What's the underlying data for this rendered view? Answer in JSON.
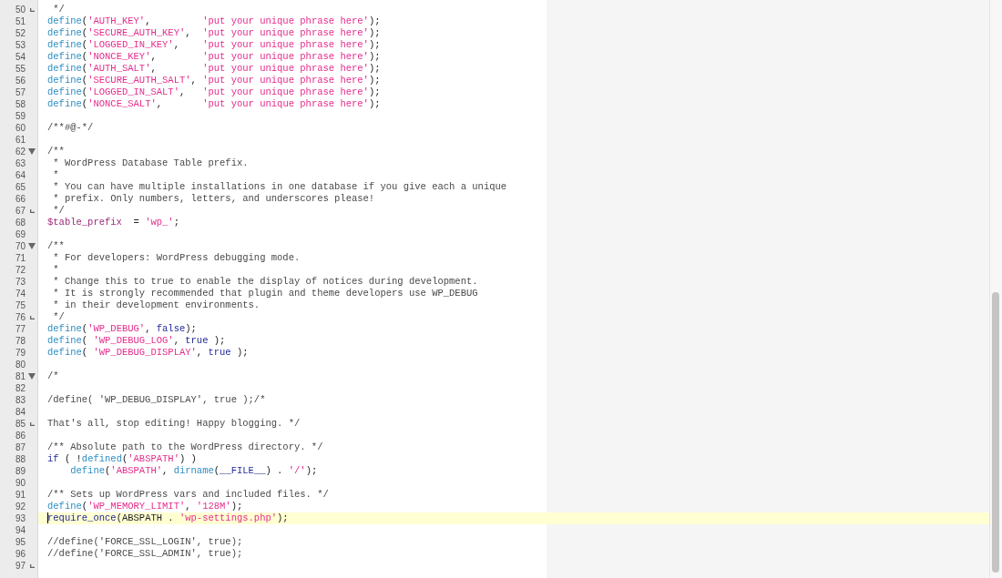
{
  "editor": {
    "lines": [
      {
        "number": "50",
        "fold_start": false,
        "fold_end": true,
        "current": false,
        "tokens": [
          {
            "kind": "comment",
            "text": " */"
          }
        ]
      },
      {
        "number": "51",
        "fold_start": false,
        "fold_end": false,
        "current": false,
        "tokens": [
          {
            "kind": "function",
            "text": "define"
          },
          {
            "kind": "plain",
            "text": "("
          },
          {
            "kind": "string",
            "text": "'AUTH_KEY'"
          },
          {
            "kind": "plain",
            "text": ",         "
          },
          {
            "kind": "string",
            "text": "'put your unique phrase here'"
          },
          {
            "kind": "plain",
            "text": ");"
          }
        ]
      },
      {
        "number": "52",
        "fold_start": false,
        "fold_end": false,
        "current": false,
        "tokens": [
          {
            "kind": "function",
            "text": "define"
          },
          {
            "kind": "plain",
            "text": "("
          },
          {
            "kind": "string",
            "text": "'SECURE_AUTH_KEY'"
          },
          {
            "kind": "plain",
            "text": ",  "
          },
          {
            "kind": "string",
            "text": "'put your unique phrase here'"
          },
          {
            "kind": "plain",
            "text": ");"
          }
        ]
      },
      {
        "number": "53",
        "fold_start": false,
        "fold_end": false,
        "current": false,
        "tokens": [
          {
            "kind": "function",
            "text": "define"
          },
          {
            "kind": "plain",
            "text": "("
          },
          {
            "kind": "string",
            "text": "'LOGGED_IN_KEY'"
          },
          {
            "kind": "plain",
            "text": ",    "
          },
          {
            "kind": "string",
            "text": "'put your unique phrase here'"
          },
          {
            "kind": "plain",
            "text": ");"
          }
        ]
      },
      {
        "number": "54",
        "fold_start": false,
        "fold_end": false,
        "current": false,
        "tokens": [
          {
            "kind": "function",
            "text": "define"
          },
          {
            "kind": "plain",
            "text": "("
          },
          {
            "kind": "string",
            "text": "'NONCE_KEY'"
          },
          {
            "kind": "plain",
            "text": ",        "
          },
          {
            "kind": "string",
            "text": "'put your unique phrase here'"
          },
          {
            "kind": "plain",
            "text": ");"
          }
        ]
      },
      {
        "number": "55",
        "fold_start": false,
        "fold_end": false,
        "current": false,
        "tokens": [
          {
            "kind": "function",
            "text": "define"
          },
          {
            "kind": "plain",
            "text": "("
          },
          {
            "kind": "string",
            "text": "'AUTH_SALT'"
          },
          {
            "kind": "plain",
            "text": ",        "
          },
          {
            "kind": "string",
            "text": "'put your unique phrase here'"
          },
          {
            "kind": "plain",
            "text": ");"
          }
        ]
      },
      {
        "number": "56",
        "fold_start": false,
        "fold_end": false,
        "current": false,
        "tokens": [
          {
            "kind": "function",
            "text": "define"
          },
          {
            "kind": "plain",
            "text": "("
          },
          {
            "kind": "string",
            "text": "'SECURE_AUTH_SALT'"
          },
          {
            "kind": "plain",
            "text": ", "
          },
          {
            "kind": "string",
            "text": "'put your unique phrase here'"
          },
          {
            "kind": "plain",
            "text": ");"
          }
        ]
      },
      {
        "number": "57",
        "fold_start": false,
        "fold_end": false,
        "current": false,
        "tokens": [
          {
            "kind": "function",
            "text": "define"
          },
          {
            "kind": "plain",
            "text": "("
          },
          {
            "kind": "string",
            "text": "'LOGGED_IN_SALT'"
          },
          {
            "kind": "plain",
            "text": ",   "
          },
          {
            "kind": "string",
            "text": "'put your unique phrase here'"
          },
          {
            "kind": "plain",
            "text": ");"
          }
        ]
      },
      {
        "number": "58",
        "fold_start": false,
        "fold_end": false,
        "current": false,
        "tokens": [
          {
            "kind": "function",
            "text": "define"
          },
          {
            "kind": "plain",
            "text": "("
          },
          {
            "kind": "string",
            "text": "'NONCE_SALT'"
          },
          {
            "kind": "plain",
            "text": ",       "
          },
          {
            "kind": "string",
            "text": "'put your unique phrase here'"
          },
          {
            "kind": "plain",
            "text": ");"
          }
        ]
      },
      {
        "number": "59",
        "fold_start": false,
        "fold_end": false,
        "current": false
      },
      {
        "number": "60",
        "fold_start": false,
        "fold_end": false,
        "current": false,
        "tokens": [
          {
            "kind": "comment",
            "text": "/**#@-*/"
          }
        ]
      },
      {
        "number": "61",
        "fold_start": false,
        "fold_end": false,
        "current": false
      },
      {
        "number": "62",
        "fold_start": true,
        "fold_end": false,
        "current": false,
        "tokens": [
          {
            "kind": "comment",
            "text": "/**"
          }
        ]
      },
      {
        "number": "63",
        "fold_start": false,
        "fold_end": false,
        "current": false,
        "tokens": [
          {
            "kind": "comment",
            "text": " * WordPress Database Table prefix."
          }
        ]
      },
      {
        "number": "64",
        "fold_start": false,
        "fold_end": false,
        "current": false,
        "tokens": [
          {
            "kind": "comment",
            "text": " *"
          }
        ]
      },
      {
        "number": "65",
        "fold_start": false,
        "fold_end": false,
        "current": false,
        "tokens": [
          {
            "kind": "comment",
            "text": " * You can have multiple installations in one database if you give each a unique"
          }
        ]
      },
      {
        "number": "66",
        "fold_start": false,
        "fold_end": false,
        "current": false,
        "tokens": [
          {
            "kind": "comment",
            "text": " * prefix. Only numbers, letters, and underscores please!"
          }
        ]
      },
      {
        "number": "67",
        "fold_start": false,
        "fold_end": true,
        "current": false,
        "tokens": [
          {
            "kind": "comment",
            "text": " */"
          }
        ]
      },
      {
        "number": "68",
        "fold_start": false,
        "fold_end": false,
        "current": false,
        "tokens": [
          {
            "kind": "variable",
            "text": "$table_prefix"
          },
          {
            "kind": "plain",
            "text": "  = "
          },
          {
            "kind": "string",
            "text": "'wp_'"
          },
          {
            "kind": "plain",
            "text": ";"
          }
        ]
      },
      {
        "number": "69",
        "fold_start": false,
        "fold_end": false,
        "current": false
      },
      {
        "number": "70",
        "fold_start": true,
        "fold_end": false,
        "current": false,
        "tokens": [
          {
            "kind": "comment",
            "text": "/**"
          }
        ]
      },
      {
        "number": "71",
        "fold_start": false,
        "fold_end": false,
        "current": false,
        "tokens": [
          {
            "kind": "comment",
            "text": " * For developers: WordPress debugging mode."
          }
        ]
      },
      {
        "number": "72",
        "fold_start": false,
        "fold_end": false,
        "current": false,
        "tokens": [
          {
            "kind": "comment",
            "text": " *"
          }
        ]
      },
      {
        "number": "73",
        "fold_start": false,
        "fold_end": false,
        "current": false,
        "tokens": [
          {
            "kind": "comment",
            "text": " * Change this to true to enable the display of notices during development."
          }
        ]
      },
      {
        "number": "74",
        "fold_start": false,
        "fold_end": false,
        "current": false,
        "tokens": [
          {
            "kind": "comment",
            "text": " * It is strongly recommended that plugin and theme developers use WP_DEBUG"
          }
        ]
      },
      {
        "number": "75",
        "fold_start": false,
        "fold_end": false,
        "current": false,
        "tokens": [
          {
            "kind": "comment",
            "text": " * in their development environments."
          }
        ]
      },
      {
        "number": "76",
        "fold_start": false,
        "fold_end": true,
        "current": false,
        "tokens": [
          {
            "kind": "comment",
            "text": " */"
          }
        ]
      },
      {
        "number": "77",
        "fold_start": false,
        "fold_end": false,
        "current": false,
        "tokens": [
          {
            "kind": "function",
            "text": "define"
          },
          {
            "kind": "plain",
            "text": "("
          },
          {
            "kind": "string",
            "text": "'WP_DEBUG'"
          },
          {
            "kind": "plain",
            "text": ", "
          },
          {
            "kind": "keyword",
            "text": "false"
          },
          {
            "kind": "plain",
            "text": ");"
          }
        ]
      },
      {
        "number": "78",
        "fold_start": false,
        "fold_end": false,
        "current": false,
        "tokens": [
          {
            "kind": "function",
            "text": "define"
          },
          {
            "kind": "plain",
            "text": "( "
          },
          {
            "kind": "string",
            "text": "'WP_DEBUG_LOG'"
          },
          {
            "kind": "plain",
            "text": ", "
          },
          {
            "kind": "keyword",
            "text": "true"
          },
          {
            "kind": "plain",
            "text": " );"
          }
        ]
      },
      {
        "number": "79",
        "fold_start": false,
        "fold_end": false,
        "current": false,
        "tokens": [
          {
            "kind": "function",
            "text": "define"
          },
          {
            "kind": "plain",
            "text": "( "
          },
          {
            "kind": "string",
            "text": "'WP_DEBUG_DISPLAY'"
          },
          {
            "kind": "plain",
            "text": ", "
          },
          {
            "kind": "keyword",
            "text": "true"
          },
          {
            "kind": "plain",
            "text": " );"
          }
        ]
      },
      {
        "number": "80",
        "fold_start": false,
        "fold_end": false,
        "current": false
      },
      {
        "number": "81",
        "fold_start": true,
        "fold_end": false,
        "current": false,
        "tokens": [
          {
            "kind": "comment",
            "text": "/*"
          }
        ]
      },
      {
        "number": "82",
        "fold_start": false,
        "fold_end": false,
        "current": false
      },
      {
        "number": "83",
        "fold_start": false,
        "fold_end": false,
        "current": false,
        "tokens": [
          {
            "kind": "comment",
            "text": "/define( 'WP_DEBUG_DISPLAY', true );/*"
          }
        ]
      },
      {
        "number": "84",
        "fold_start": false,
        "fold_end": false,
        "current": false
      },
      {
        "number": "85",
        "fold_start": false,
        "fold_end": true,
        "current": false,
        "tokens": [
          {
            "kind": "comment",
            "text": "That's all, stop editing! Happy blogging. */"
          }
        ]
      },
      {
        "number": "86",
        "fold_start": false,
        "fold_end": false,
        "current": false
      },
      {
        "number": "87",
        "fold_start": false,
        "fold_end": false,
        "current": false,
        "tokens": [
          {
            "kind": "comment",
            "text": "/** Absolute path to the WordPress directory. */"
          }
        ]
      },
      {
        "number": "88",
        "fold_start": false,
        "fold_end": false,
        "current": false,
        "tokens": [
          {
            "kind": "keyword",
            "text": "if"
          },
          {
            "kind": "plain",
            "text": " ( !"
          },
          {
            "kind": "function",
            "text": "defined"
          },
          {
            "kind": "plain",
            "text": "("
          },
          {
            "kind": "string",
            "text": "'ABSPATH'"
          },
          {
            "kind": "plain",
            "text": ") )"
          }
        ]
      },
      {
        "number": "89",
        "fold_start": false,
        "fold_end": false,
        "current": false,
        "tokens": [
          {
            "kind": "function",
            "text": "    define"
          },
          {
            "kind": "plain",
            "text": "("
          },
          {
            "kind": "string",
            "text": "'ABSPATH'"
          },
          {
            "kind": "plain",
            "text": ", "
          },
          {
            "kind": "function",
            "text": "dirname"
          },
          {
            "kind": "plain",
            "text": "("
          },
          {
            "kind": "keyword",
            "text": "__FILE__"
          },
          {
            "kind": "plain",
            "text": ") . "
          },
          {
            "kind": "string",
            "text": "'/'"
          },
          {
            "kind": "plain",
            "text": ");"
          }
        ]
      },
      {
        "number": "90",
        "fold_start": false,
        "fold_end": false,
        "current": false
      },
      {
        "number": "91",
        "fold_start": false,
        "fold_end": false,
        "current": false,
        "tokens": [
          {
            "kind": "comment",
            "text": "/** Sets up WordPress vars and included files. */"
          }
        ]
      },
      {
        "number": "92",
        "fold_start": false,
        "fold_end": false,
        "current": false,
        "tokens": [
          {
            "kind": "function",
            "text": "define"
          },
          {
            "kind": "plain",
            "text": "("
          },
          {
            "kind": "string",
            "text": "'WP_MEMORY_LIMIT'"
          },
          {
            "kind": "plain",
            "text": ", "
          },
          {
            "kind": "string",
            "text": "'128M'"
          },
          {
            "kind": "plain",
            "text": ");"
          }
        ]
      },
      {
        "number": "93",
        "fold_start": false,
        "fold_end": false,
        "current": true,
        "tokens": [
          {
            "kind": "keyword",
            "text": "require_once"
          },
          {
            "kind": "plain",
            "text": "(ABSPATH . "
          },
          {
            "kind": "string",
            "text": "'wp-settings.php'"
          },
          {
            "kind": "plain",
            "text": ");"
          }
        ]
      },
      {
        "number": "94",
        "fold_start": false,
        "fold_end": false,
        "current": false
      },
      {
        "number": "95",
        "fold_start": false,
        "fold_end": false,
        "current": false,
        "tokens": [
          {
            "kind": "comment",
            "text": "//define('FORCE_SSL_LOGIN', true);"
          }
        ]
      },
      {
        "number": "96",
        "fold_start": false,
        "fold_end": false,
        "current": false,
        "tokens": [
          {
            "kind": "comment",
            "text": "//define('FORCE_SSL_ADMIN', true);"
          }
        ]
      },
      {
        "number": "97",
        "fold_start": false,
        "fold_end": true,
        "current": false
      }
    ]
  }
}
